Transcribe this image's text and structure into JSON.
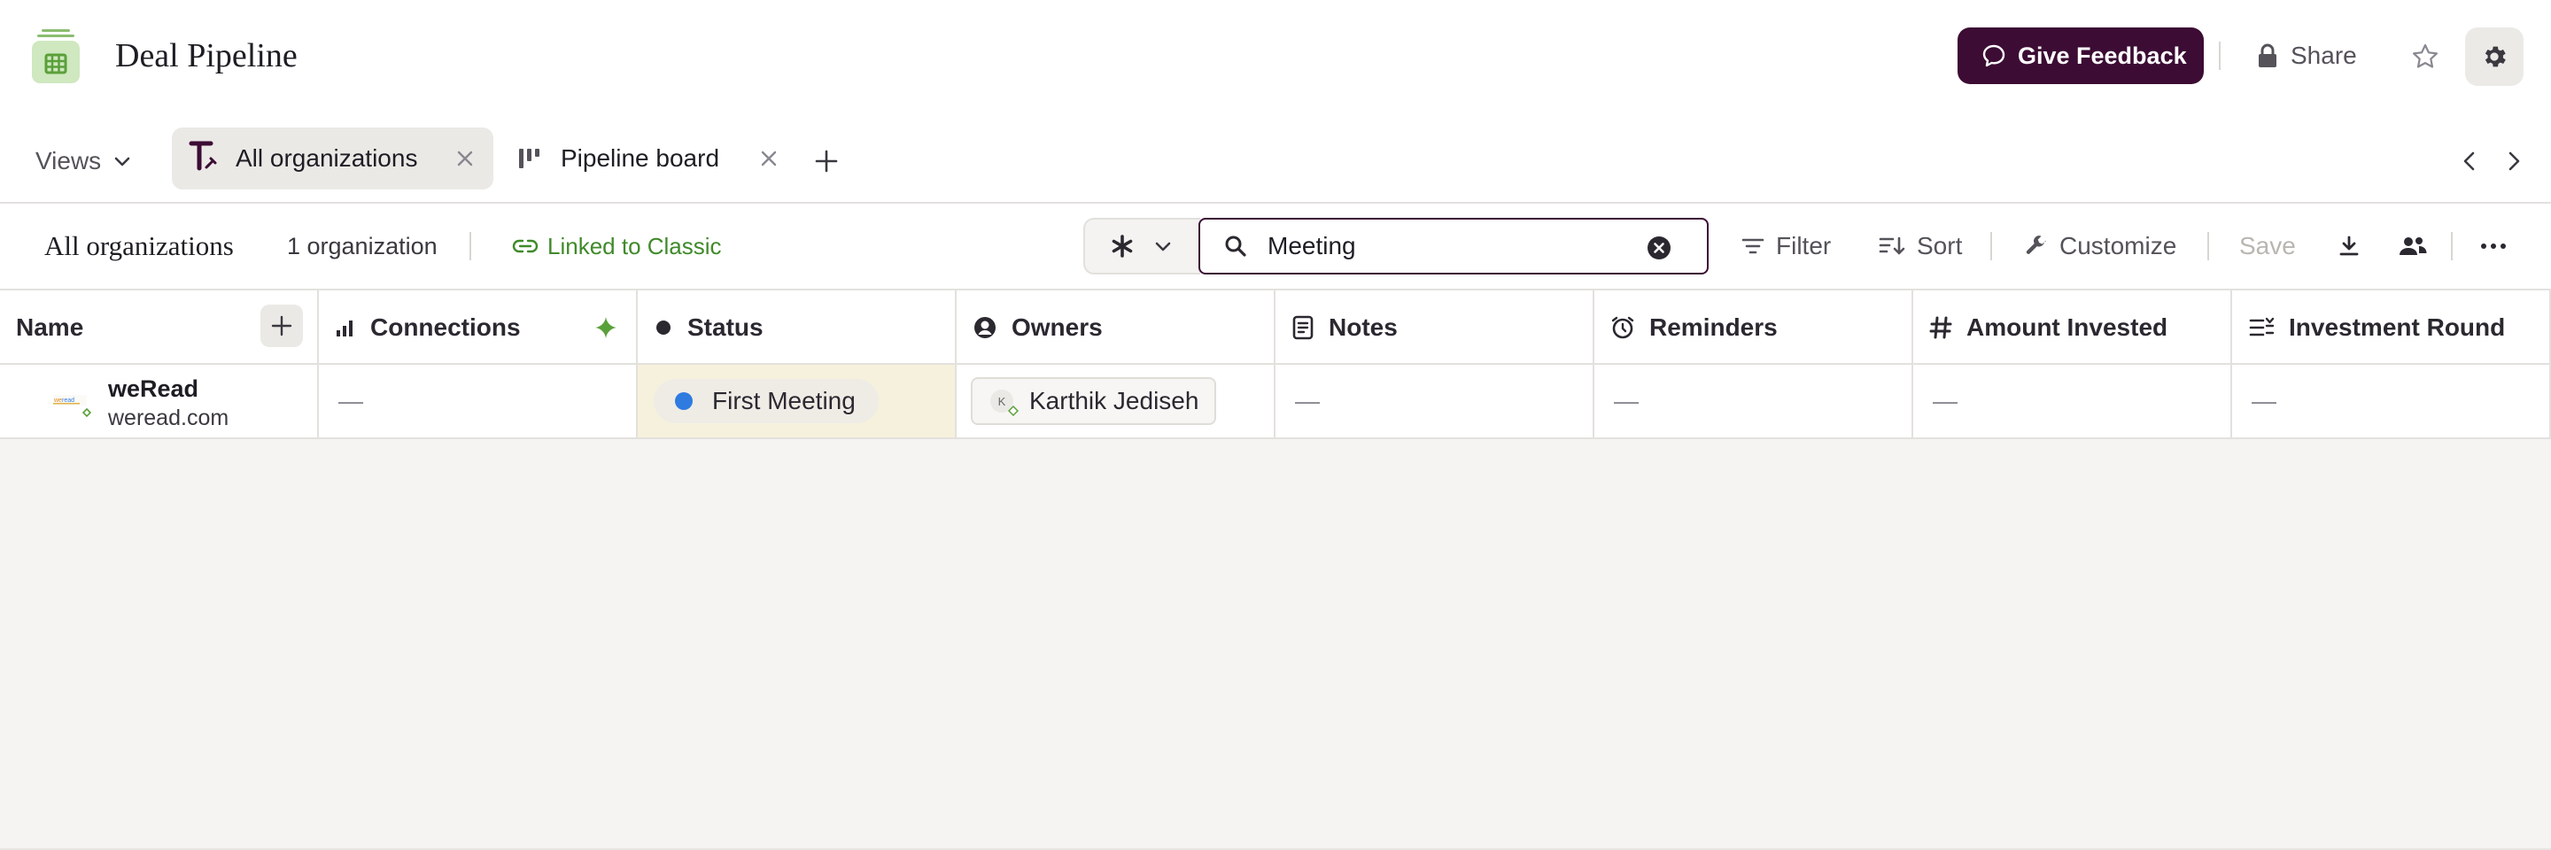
{
  "header": {
    "title": "Deal Pipeline",
    "feedback_label": "Give Feedback",
    "share_label": "Share",
    "accent": "#3c0c34"
  },
  "views": {
    "dropdown_label": "Views",
    "tabs": [
      {
        "label": "All organizations",
        "icon": "pinned-table-icon"
      },
      {
        "label": "Pipeline board",
        "icon": "kanban-icon"
      }
    ]
  },
  "toolbar": {
    "list_title": "All organizations",
    "count": "1 organization",
    "linked_label": "Linked to Classic",
    "search_value": "Meeting",
    "filter_label": "Filter",
    "sort_label": "Sort",
    "customize_label": "Customize",
    "save_label": "Save"
  },
  "table": {
    "columns": [
      {
        "label": "Name"
      },
      {
        "label": "Connections"
      },
      {
        "label": "Status"
      },
      {
        "label": "Owners"
      },
      {
        "label": "Notes"
      },
      {
        "label": "Reminders"
      },
      {
        "label": "Amount Invested"
      },
      {
        "label": "Investment Round"
      }
    ],
    "rows": [
      {
        "name": "weRead",
        "domain": "weread.com",
        "connections": "—",
        "status": "First Meeting",
        "status_color": "#2f7be0",
        "owner": "Karthik Jediseh",
        "owner_initials": "K",
        "notes": "—",
        "reminders": "—",
        "amount_invested": "—",
        "investment_round": "—"
      }
    ]
  }
}
